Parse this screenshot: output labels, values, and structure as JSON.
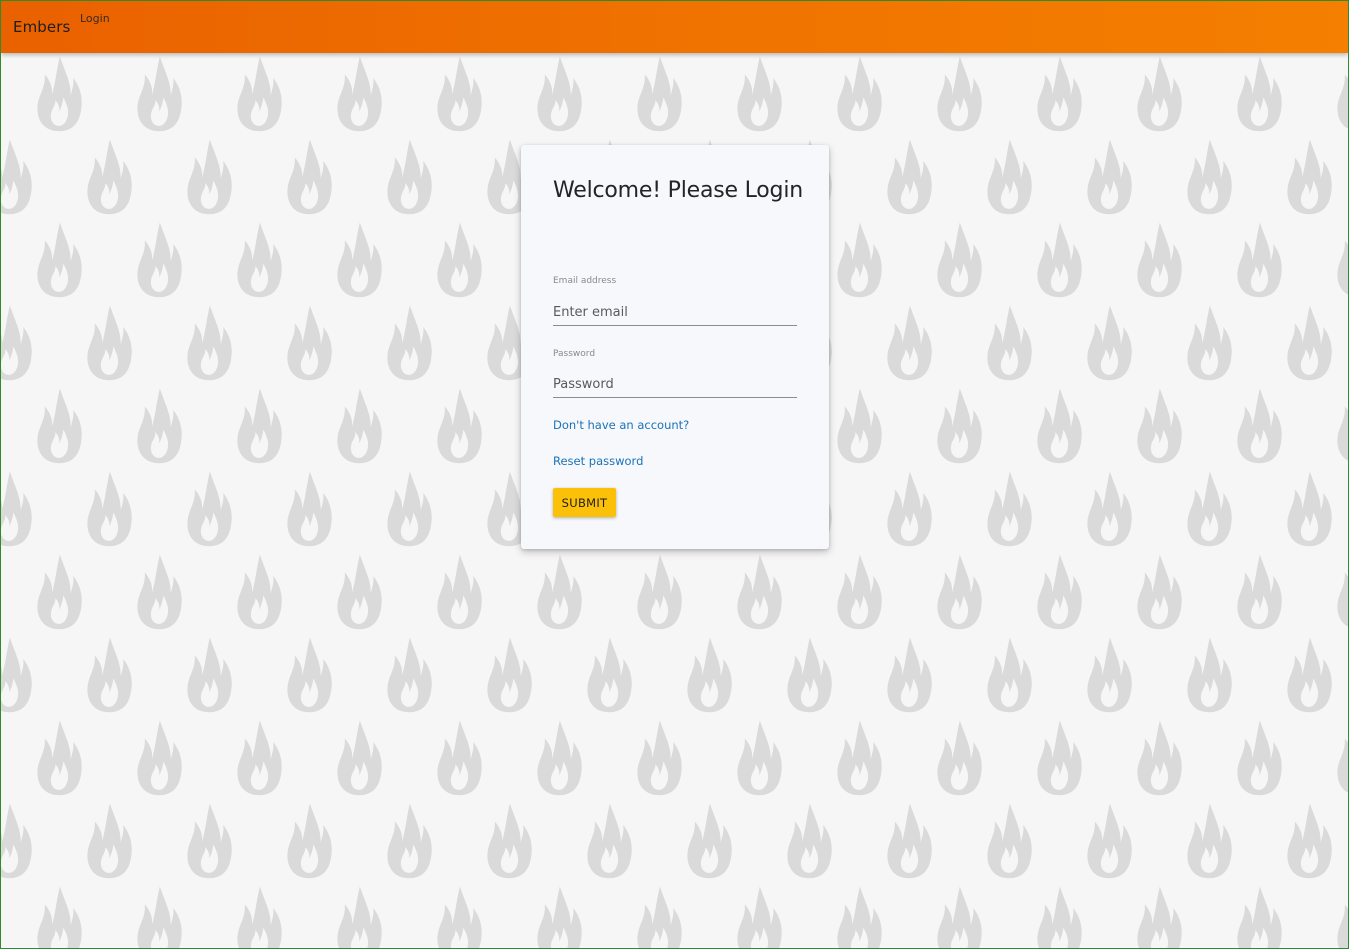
{
  "appbar": {
    "brand": "Embers",
    "nav_login": "Login",
    "colors": {
      "gradient_start": "#ea6100",
      "gradient_end": "#f47f00"
    }
  },
  "background": {
    "pattern_icon": "flame-icon",
    "color": "#f6f6f6",
    "pattern_color": "#dadada"
  },
  "login_card": {
    "title": "Welcome! Please Login",
    "email": {
      "label": "Email address",
      "placeholder": "Enter email",
      "value": ""
    },
    "password": {
      "label": "Password",
      "placeholder": "Password",
      "value": ""
    },
    "signup_link": "Don't have an account?",
    "reset_link": "Reset password",
    "submit_label": "SUBMIT",
    "colors": {
      "link": "#1a73b8",
      "submit": "#fbc108"
    }
  }
}
